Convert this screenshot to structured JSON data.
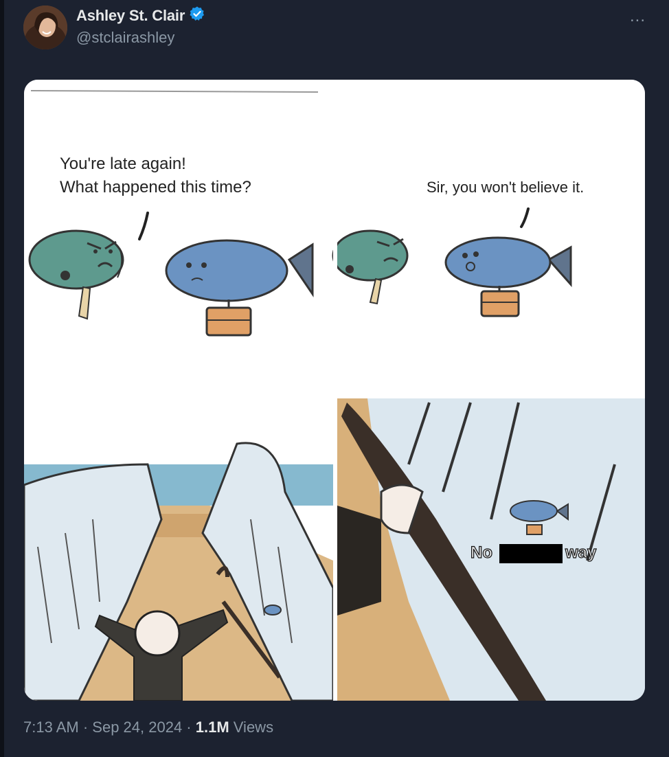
{
  "author": {
    "name": "Ashley St. Clair",
    "handle": "@stclairashley",
    "verified": true,
    "verified_color": "#1d9bf0"
  },
  "more_menu": "...",
  "comic": {
    "panel1_line1": "You're late again!",
    "panel1_line2": "What happened this time?",
    "panel2_speech": "Sir, you won't believe it.",
    "panel4_word_left": "No",
    "panel4_word_right": "way"
  },
  "meta": {
    "time": "7:13 AM",
    "separator": " · ",
    "date": "Sep 24, 2024",
    "views_count": "1.1M",
    "views_label": " Views"
  },
  "icons": {
    "verified": "verified-badge-icon",
    "more": "more-horizontal-icon"
  }
}
